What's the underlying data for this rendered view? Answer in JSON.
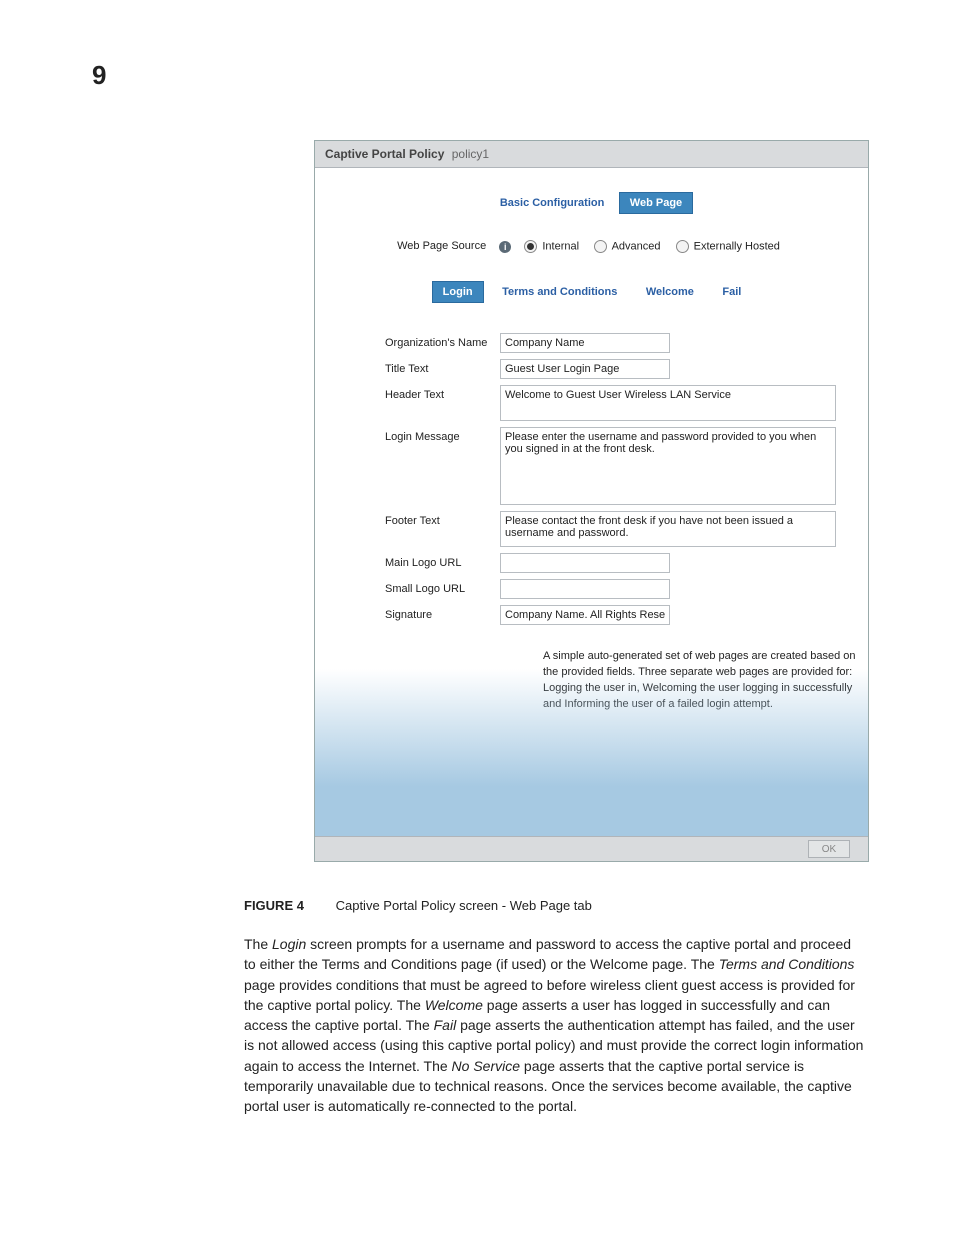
{
  "page_number": "9",
  "header": {
    "title_bold": "Captive Portal Policy",
    "title_policy": "policy1"
  },
  "top_tabs": {
    "basic": "Basic Configuration",
    "web_page": "Web Page"
  },
  "source_row": {
    "label": "Web Page Source",
    "options": {
      "internal": "Internal",
      "advanced": "Advanced",
      "external": "Externally Hosted"
    }
  },
  "sub_tabs": {
    "login": "Login",
    "terms": "Terms and Conditions",
    "welcome": "Welcome",
    "fail": "Fail"
  },
  "form": {
    "org_label": "Organization's Name",
    "org_value": "Company Name",
    "title_label": "Title Text",
    "title_value": "Guest User Login Page",
    "header_label": "Header Text",
    "header_value": "Welcome to Guest User Wireless LAN Service",
    "login_msg_label": "Login Message",
    "login_msg_value": "Please enter the username and password provided to you when you signed in at the front desk.",
    "footer_label": "Footer Text",
    "footer_value": "Please contact the front desk if you have not been issued a username and password.",
    "main_logo_label": "Main Logo URL",
    "main_logo_value": "",
    "small_logo_label": "Small Logo URL",
    "small_logo_value": "",
    "sig_label": "Signature",
    "sig_value": "Company Name. All Rights Reserv"
  },
  "description": "A simple auto-generated set of web pages are created based on the provided fields. Three separate web pages are provided for: Logging the user in, Welcoming the user logging in successfully and Informing the user of a failed login attempt.",
  "buttons": {
    "ok": "OK"
  },
  "caption": {
    "label": "FIGURE 4",
    "title": "Captive Portal Policy screen - Web Page tab"
  },
  "para": {
    "t1": "The ",
    "login": "Login",
    "t2": " screen prompts for a username and password to access the captive portal and proceed to either the Terms and Conditions page (if used) or the Welcome page. The ",
    "terms": "Terms and Conditions",
    "t3": " page provides conditions that must be agreed to before wireless client guest access is provided for the captive portal policy. The ",
    "welcome": "Welcome",
    "t4": " page asserts a user has logged in successfully and can access the captive portal. The ",
    "fail": "Fail",
    "t5": " page asserts the authentication attempt has failed, and the user is not allowed access (using this captive portal policy) and must provide the correct login information again to access the Internet. The ",
    "noservice": "No Service",
    "t6": " page asserts that the captive portal service is temporarily unavailable due to technical reasons. Once the services become available, the captive portal user is automatically re-connected to the portal."
  }
}
